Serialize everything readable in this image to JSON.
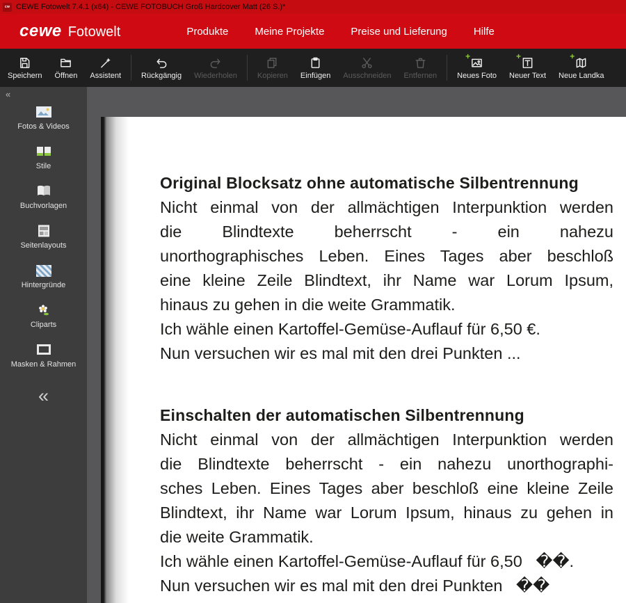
{
  "window": {
    "title": "CEWE Fotowelt 7.4.1 (x64) - CEWE FOTOBUCH Groß Hardcover Matt (26 S.)*"
  },
  "menubar": {
    "logo_primary": "cewe",
    "logo_secondary": "Fotowelt",
    "items": [
      {
        "label": "Produkte"
      },
      {
        "label": "Meine Projekte"
      },
      {
        "label": "Preise und Lieferung"
      },
      {
        "label": "Hilfe"
      }
    ]
  },
  "toolbar": {
    "buttons": [
      {
        "label": "Speichern",
        "enabled": true
      },
      {
        "label": "Öffnen",
        "enabled": true
      },
      {
        "label": "Assistent",
        "enabled": true
      },
      {
        "label": "Rückgängig",
        "enabled": true
      },
      {
        "label": "Wiederholen",
        "enabled": false
      },
      {
        "label": "Kopieren",
        "enabled": false
      },
      {
        "label": "Einfügen",
        "enabled": true
      },
      {
        "label": "Ausschneiden",
        "enabled": false
      },
      {
        "label": "Entfernen",
        "enabled": false
      },
      {
        "label": "Neues Foto",
        "enabled": true
      },
      {
        "label": "Neuer Text",
        "enabled": true
      },
      {
        "label": "Neue Landka",
        "enabled": true
      }
    ]
  },
  "sidebar": {
    "collapse_top": "«",
    "collapse_bottom": "«",
    "items": [
      {
        "label": "Fotos & Videos"
      },
      {
        "label": "Stile"
      },
      {
        "label": "Buchvorlagen"
      },
      {
        "label": "Seitenlayouts"
      },
      {
        "label": "Hintergründe"
      },
      {
        "label": "Cliparts"
      },
      {
        "label": "Masken & Rahmen"
      }
    ]
  },
  "page": {
    "sections": [
      {
        "heading": "Original Blocksatz ohne automatische Silbentrennung",
        "justified_lines": [
          "Nicht einmal von der allmächtigen Interpunktion werden",
          "die Blindtexte beherrscht - ein nahezu",
          "unorthographisches Leben. Eines Tages aber beschloß",
          "eine kleine Zeile Blindtext, ihr Name war Lorum Ipsum,"
        ],
        "last_line": "hinaus zu gehen in die weite Grammatik.",
        "plain_lines": [
          "Ich wähle einen Kartoffel-Gemüse-Auflauf für 6,50 €.",
          "Nun versuchen wir es mal mit den drei Punkten ..."
        ]
      },
      {
        "heading": "Einschalten der automatischen Silbentrennung",
        "justified_lines": [
          "Nicht einmal von der allmächtigen Interpunktion werden",
          "die Blindtexte beherrscht - ein nahezu unorthographi-",
          "sches Leben. Eines Tages aber beschloß eine kleine Zeile",
          "Blindtext, ihr Name war Lorum Ipsum, hinaus zu gehen in"
        ],
        "last_line": "die weite Grammatik.",
        "plain_lines": [
          "Ich wähle einen Kartoffel-Gemüse-Auflauf für 6,50   ��.",
          "Nun versuchen wir es mal mit den drei Punkten   ��"
        ]
      }
    ]
  },
  "colors": {
    "cewe_red": "#cf0a12",
    "toolbar_bg": "#1f1f1f",
    "sidebar_bg": "#3d3d3d",
    "canvas_bg": "#57575a",
    "page_bg": "#ffffff",
    "accent_green": "#8dc63f"
  }
}
